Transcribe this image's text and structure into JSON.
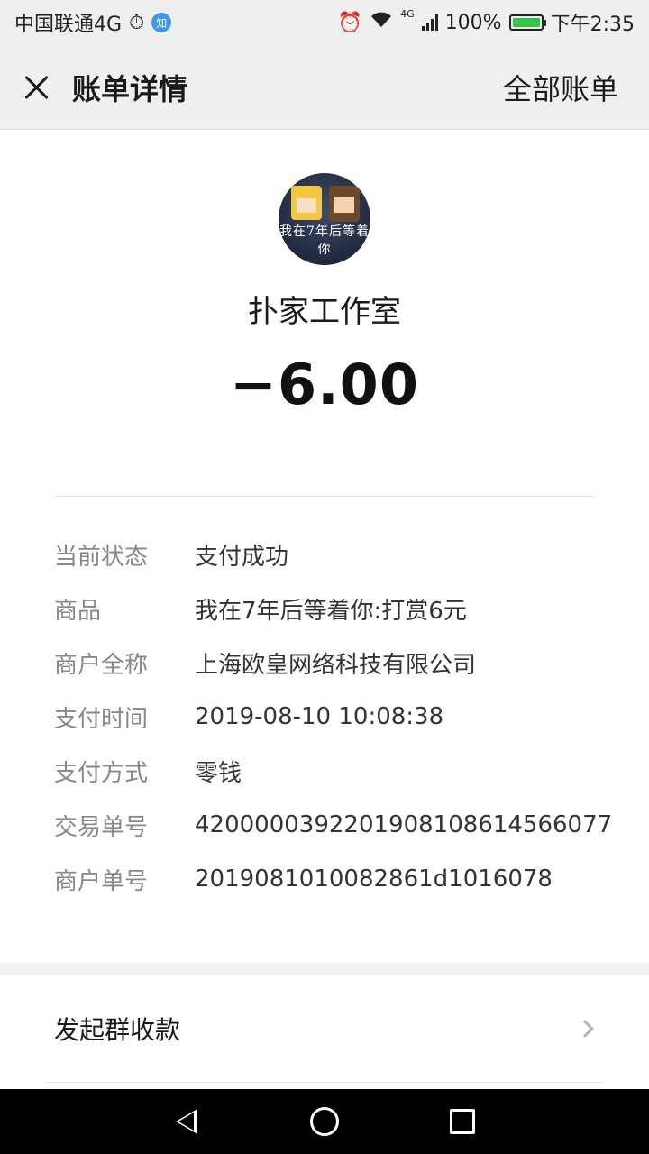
{
  "status_bar": {
    "carrier": "中国联通4G",
    "badge": "知",
    "network_label": "4G",
    "battery": "100%",
    "battery_level": 1.0,
    "time": "下午2:35"
  },
  "header": {
    "title": "账单详情",
    "action": "全部账单"
  },
  "merchant": {
    "avatar_text": "我在7年后等着你",
    "name": "扑家工作室",
    "amount": "−6.00"
  },
  "details": [
    {
      "label": "当前状态",
      "value": "支付成功"
    },
    {
      "label": "商品",
      "value": "我在7年后等着你:打赏6元"
    },
    {
      "label": "商户全称",
      "value": "上海欧皇网络科技有限公司"
    },
    {
      "label": "支付时间",
      "value": "2019-08-10 10:08:38"
    },
    {
      "label": "支付方式",
      "value": "零钱"
    },
    {
      "label": "交易单号",
      "value": "4200000392201908108614566077"
    },
    {
      "label": "商户单号",
      "value": "2019081010082861d1016078"
    }
  ],
  "actions": {
    "group_pay": "发起群收款"
  },
  "colors": {
    "amount": "#111111",
    "label_gray": "#888888",
    "battery_green": "#35c44a"
  }
}
